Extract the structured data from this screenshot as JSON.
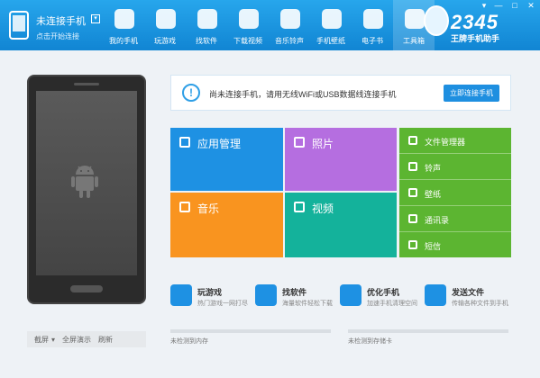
{
  "header": {
    "connection": {
      "title": "未连接手机",
      "dropdown_symbol": "▾",
      "subtitle": "点击开始连接"
    },
    "nav": [
      {
        "label": "我的手机",
        "icon": "phone-icon",
        "color": "#ffffff"
      },
      {
        "label": "玩游戏",
        "icon": "gamepad-icon",
        "color": "#ffffff"
      },
      {
        "label": "找软件",
        "icon": "app-store-icon",
        "color": "#ffffff"
      },
      {
        "label": "下载视频",
        "icon": "film-icon",
        "color": "#ffffff"
      },
      {
        "label": "音乐铃声",
        "icon": "music-icon",
        "color": "#ffffff"
      },
      {
        "label": "手机壁纸",
        "icon": "wallpaper-icon",
        "color": "#ffffff"
      },
      {
        "label": "电子书",
        "icon": "book-icon",
        "color": "#ffffff"
      },
      {
        "label": "工具箱",
        "icon": "toolbox-icon",
        "color": "#ffffff",
        "active": true
      }
    ],
    "brand": {
      "number": "2345",
      "tagline": "王牌手机助手"
    },
    "window_controls": {
      "menu": "▾",
      "minimize": "—",
      "maximize": "□",
      "close": "✕"
    }
  },
  "device_panel": {
    "screenshot_label": "截屏",
    "screenshot_arrow": "▾",
    "fullscreen_label": "全屏演示",
    "refresh_label": "刷新"
  },
  "banner": {
    "message": "尚未连接手机，请用无线WiFi或USB数据线连接手机",
    "button_label": "立即连接手机"
  },
  "tiles": {
    "app_management": "应用管理",
    "photos": "照片",
    "music": "音乐",
    "video": "视频",
    "side": [
      "文件管理器",
      "铃声",
      "壁纸",
      "通讯录",
      "短信"
    ]
  },
  "shortcuts": [
    {
      "title": "玩游戏",
      "subtitle": "热门游戏一网打尽"
    },
    {
      "title": "找软件",
      "subtitle": "海量软件轻松下载"
    },
    {
      "title": "优化手机",
      "subtitle": "加速手机清理空间"
    },
    {
      "title": "发送文件",
      "subtitle": "传输各种文件到手机"
    }
  ],
  "storage": {
    "internal": "未检测到内存",
    "sdcard": "未检测到存储卡"
  },
  "colors": {
    "header": "#1b94df",
    "accent": "#1e8fe0",
    "tile_app": "#1e91e3",
    "tile_photo": "#b56ee0",
    "tile_music": "#f9941f",
    "tile_video": "#14b29b",
    "tile_side": "#5cb531"
  }
}
